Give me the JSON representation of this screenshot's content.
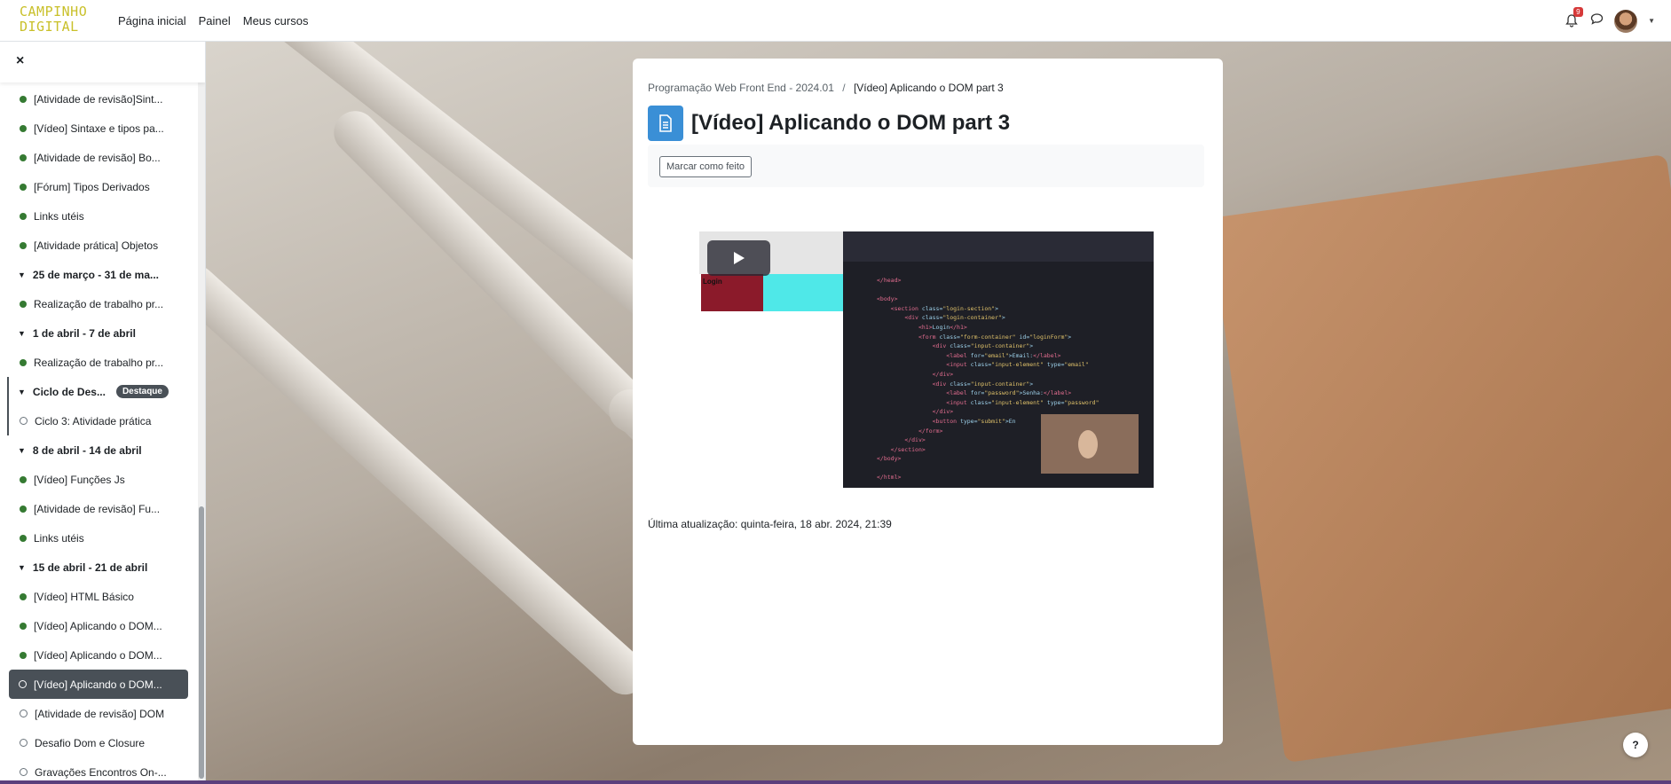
{
  "navbar": {
    "logo_line1": "CAMPINHO",
    "logo_line2": "DIGITAL",
    "links": [
      "Página inicial",
      "Painel",
      "Meus cursos"
    ],
    "notification_count": "9"
  },
  "drawer": {
    "close_label": "×",
    "items": [
      {
        "type": "activity",
        "label": "[Atividade de revisão]Sint...",
        "status": "done"
      },
      {
        "type": "activity",
        "label": "[Vídeo] Sintaxe e tipos pa...",
        "status": "done"
      },
      {
        "type": "activity",
        "label": "[Atividade de revisão] Bo...",
        "status": "done"
      },
      {
        "type": "activity",
        "label": "[Fórum] Tipos Derivados",
        "status": "done"
      },
      {
        "type": "activity",
        "label": "Links utéis",
        "status": "done"
      },
      {
        "type": "activity",
        "label": "[Atividade prática] Objetos",
        "status": "done"
      },
      {
        "type": "section",
        "label": "25 de março - 31 de ma..."
      },
      {
        "type": "activity",
        "label": "Realização de trabalho pr...",
        "status": "done"
      },
      {
        "type": "section",
        "label": "1 de abril - 7 de abril"
      },
      {
        "type": "activity",
        "label": "Realização de trabalho pr...",
        "status": "done"
      },
      {
        "type": "section",
        "label": "Ciclo de Des...",
        "badge": "Destaque"
      },
      {
        "type": "activity",
        "label": "Ciclo 3: Atividade prática",
        "status": "todo"
      },
      {
        "type": "section",
        "label": "8 de abril - 14 de abril"
      },
      {
        "type": "activity",
        "label": "[Vídeo] Funções Js",
        "status": "done"
      },
      {
        "type": "activity",
        "label": "[Atividade de revisão] Fu...",
        "status": "done"
      },
      {
        "type": "activity",
        "label": "Links utéis",
        "status": "done"
      },
      {
        "type": "section",
        "label": "15 de abril - 21 de abril"
      },
      {
        "type": "activity",
        "label": "[Vídeo] HTML Básico",
        "status": "done"
      },
      {
        "type": "activity",
        "label": "[Vídeo] Aplicando o DOM...",
        "status": "done"
      },
      {
        "type": "activity",
        "label": "[Vídeo] Aplicando o DOM...",
        "status": "done"
      },
      {
        "type": "activity",
        "label": "[Vídeo] Aplicando o DOM...",
        "status": "todo",
        "active": true
      },
      {
        "type": "activity",
        "label": "[Atividade de revisão] DOM",
        "status": "todo"
      },
      {
        "type": "activity",
        "label": "Desafio Dom e Closure",
        "status": "todo"
      },
      {
        "type": "activity",
        "label": "Gravações Encontros On-...",
        "status": "todo"
      }
    ]
  },
  "page": {
    "breadcrumb_course": "Programação Web Front End - 2024.01",
    "breadcrumb_separator": "/",
    "breadcrumb_current": "[Vídeo] Aplicando o DOM part 3",
    "title": "[Vídeo] Aplicando o DOM part 3",
    "mark_done_label": "Marcar como feito",
    "last_updated": "Última atualização: quinta-feira, 18 abr. 2024, 21:39"
  },
  "video": {
    "preview_heading": "Login"
  },
  "help_label": "?",
  "colors": {
    "logo": "#c9c02a",
    "done_dot": "#357a32",
    "page_icon": "#3a8fd6",
    "active_item": "#495057"
  }
}
